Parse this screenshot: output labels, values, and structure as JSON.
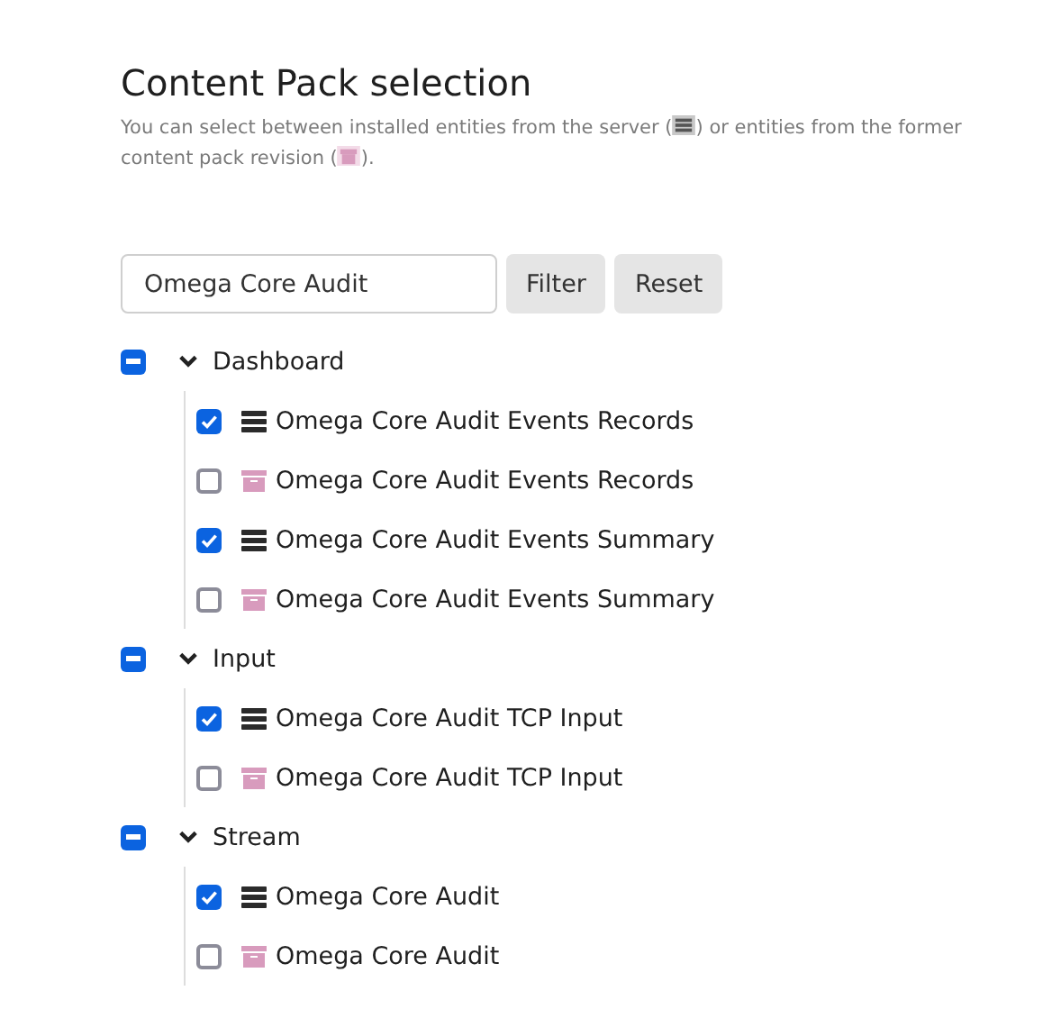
{
  "title": "Content Pack selection",
  "description": {
    "before": "You can select between installed entities from the server (",
    "middle": ") or entities from the former",
    "middle2": "content pack revision (",
    "after": ")."
  },
  "filter": {
    "value": "Omega Core Audit",
    "buttons": [
      "Filter",
      "Reset"
    ]
  },
  "groups": [
    {
      "label": "Dashboard",
      "indeterminate": true,
      "expanded": true,
      "children": [
        {
          "label": "Omega Core Audit Events Records",
          "kind": "server",
          "checked": true
        },
        {
          "label": "Omega Core Audit Events Records",
          "kind": "archive",
          "checked": false
        },
        {
          "label": "Omega Core Audit Events Summary",
          "kind": "server",
          "checked": true
        },
        {
          "label": "Omega Core Audit Events Summary",
          "kind": "archive",
          "checked": false
        }
      ]
    },
    {
      "label": "Input",
      "indeterminate": true,
      "expanded": true,
      "children": [
        {
          "label": "Omega Core Audit TCP Input",
          "kind": "server",
          "checked": true
        },
        {
          "label": "Omega Core Audit TCP Input",
          "kind": "archive",
          "checked": false
        }
      ]
    },
    {
      "label": "Stream",
      "indeterminate": true,
      "expanded": true,
      "children": [
        {
          "label": "Omega Core Audit",
          "kind": "server",
          "checked": true
        },
        {
          "label": "Omega Core Audit",
          "kind": "archive",
          "checked": false
        }
      ]
    }
  ]
}
